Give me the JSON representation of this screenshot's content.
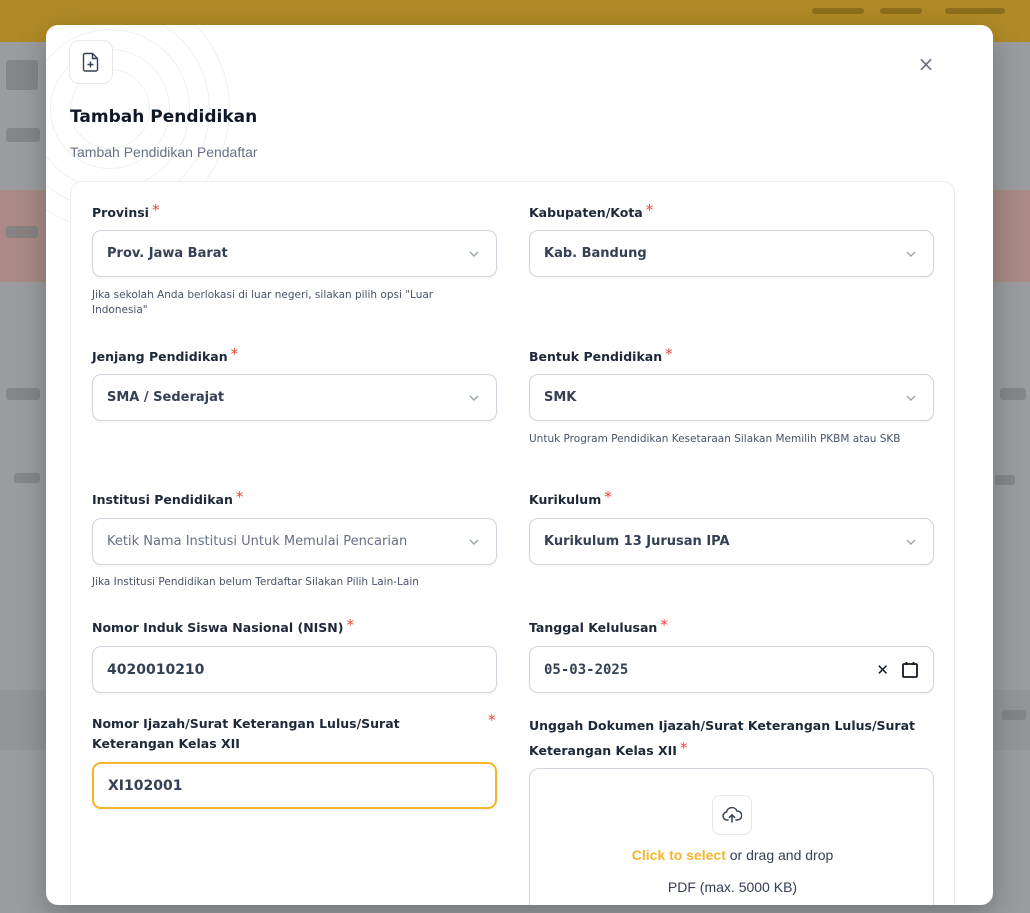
{
  "modal": {
    "title": "Tambah Pendidikan",
    "subtitle": "Tambah Pendidikan Pendaftar",
    "close_label": "×",
    "header_icon": "file-plus-icon"
  },
  "form": {
    "provinsi": {
      "label": "Provinsi",
      "value": "Prov. Jawa Barat",
      "hint": "Jika sekolah Anda berlokasi di luar negeri, silakan pilih opsi \"Luar Indonesia\""
    },
    "kabupaten": {
      "label": "Kabupaten/Kota",
      "value": "Kab. Bandung"
    },
    "jenjang": {
      "label": "Jenjang Pendidikan",
      "value": "SMA / Sederajat"
    },
    "bentuk": {
      "label": "Bentuk Pendidikan",
      "value": "SMK",
      "hint": "Untuk Program Pendidikan Kesetaraan Silakan Memilih PKBM atau SKB"
    },
    "institusi": {
      "label": "Institusi Pendidikan",
      "placeholder": "Ketik Nama Institusi Untuk Memulai Pencarian",
      "hint": "Jika Institusi Pendidikan belum Terdaftar Silakan Pilih Lain-Lain"
    },
    "kurikulum": {
      "label": "Kurikulum",
      "value": "Kurikulum 13 Jurusan IPA"
    },
    "nisn": {
      "label": "Nomor Induk Siswa Nasional (NISN)",
      "value": "4020010210"
    },
    "tanggal": {
      "label": "Tanggal Kelulusan",
      "value": "05-03-2025",
      "clear_label": "✕"
    },
    "ijazah": {
      "label": "Nomor Ijazah/Surat Keterangan Lulus/Surat Keterangan Kelas XII",
      "value": "XI102001"
    },
    "upload": {
      "label": "Unggah Dokumen Ijazah/Surat Keterangan Lulus/Surat Keterangan Kelas XII",
      "select_text": "Click to select",
      "drag_text": " or drag and drop",
      "format_text": "PDF (max. 5000 KB)"
    },
    "required_mark": "*"
  },
  "colors": {
    "accent": "#f5b52e",
    "required": "#f04438",
    "border": "#d0d5dd"
  }
}
